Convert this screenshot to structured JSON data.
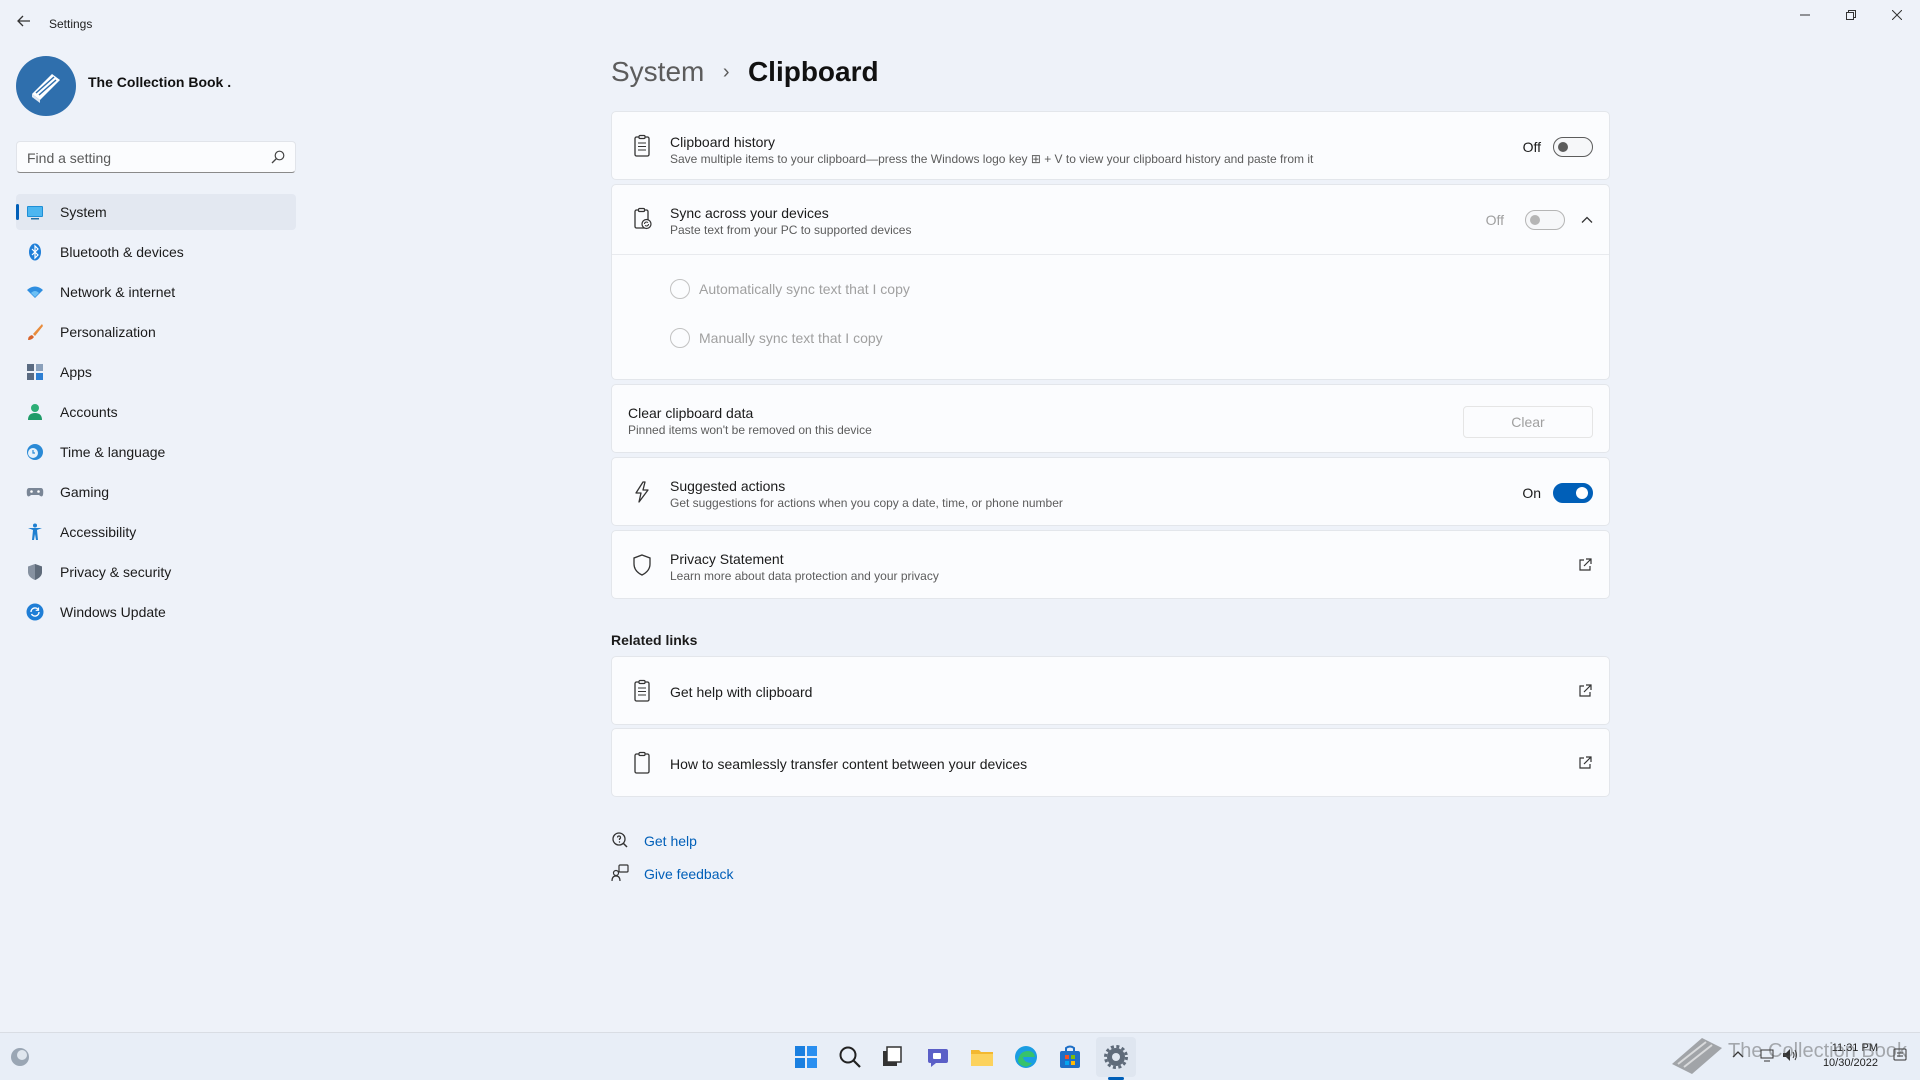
{
  "window": {
    "title": "Settings"
  },
  "profile": {
    "name": "The Collection Book ."
  },
  "search": {
    "placeholder": "Find a setting"
  },
  "sidebar": {
    "items": [
      {
        "label": "System",
        "icon": "system-icon"
      },
      {
        "label": "Bluetooth & devices",
        "icon": "bluetooth-icon"
      },
      {
        "label": "Network & internet",
        "icon": "wifi-icon"
      },
      {
        "label": "Personalization",
        "icon": "brush-icon"
      },
      {
        "label": "Apps",
        "icon": "apps-icon"
      },
      {
        "label": "Accounts",
        "icon": "person-icon"
      },
      {
        "label": "Time & language",
        "icon": "clock-globe-icon"
      },
      {
        "label": "Gaming",
        "icon": "gamepad-icon"
      },
      {
        "label": "Accessibility",
        "icon": "accessibility-icon"
      },
      {
        "label": "Privacy & security",
        "icon": "shield-icon"
      },
      {
        "label": "Windows Update",
        "icon": "update-icon"
      }
    ],
    "active_index": 0
  },
  "breadcrumb": {
    "parent": "System",
    "separator": "›",
    "current": "Clipboard"
  },
  "clipboard_history": {
    "title": "Clipboard history",
    "subtitle": "Save multiple items to your clipboard—press the Windows logo key ⊞ + V to view your clipboard history and paste from it",
    "state": "Off",
    "on": false
  },
  "sync": {
    "title": "Sync across your devices",
    "subtitle": "Paste text from your PC to supported devices",
    "state": "Off",
    "on": false,
    "disabled": true,
    "options": [
      {
        "label": "Automatically sync text that I copy",
        "selected": false
      },
      {
        "label": "Manually sync text that I copy",
        "selected": false
      }
    ]
  },
  "clear_data": {
    "title": "Clear clipboard data",
    "subtitle": "Pinned items won't be removed on this device",
    "button": "Clear"
  },
  "suggested_actions": {
    "title": "Suggested actions",
    "subtitle": "Get suggestions for actions when you copy a date, time, or phone number",
    "state": "On",
    "on": true
  },
  "privacy": {
    "title": "Privacy Statement",
    "subtitle": "Learn more about data protection and your privacy"
  },
  "related": {
    "title": "Related links",
    "links": [
      {
        "label": "Get help with clipboard"
      },
      {
        "label": "How to seamlessly transfer content between your devices"
      }
    ]
  },
  "help": {
    "get_help": "Get help",
    "feedback": "Give feedback"
  },
  "taskbar": {
    "time": "11:31 PM",
    "date": "10/30/2022"
  },
  "watermark": {
    "text": "The Collection Book"
  },
  "colors": {
    "accent": "#005fb8",
    "background": "#eef2f9",
    "card": "#fbfcfe"
  }
}
